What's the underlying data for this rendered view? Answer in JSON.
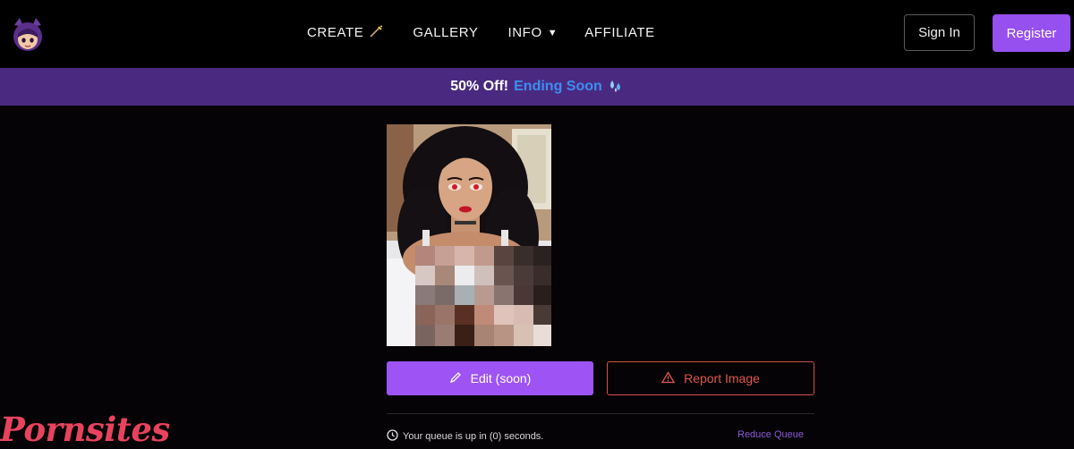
{
  "nav": {
    "links": [
      {
        "label": "CREATE",
        "icon": "wand-icon"
      },
      {
        "label": "GALLERY"
      },
      {
        "label": "INFO",
        "icon": "caret-down-icon"
      },
      {
        "label": "AFFILIATE"
      }
    ],
    "sign_in_label": "Sign In",
    "register_label": "Register"
  },
  "promo": {
    "off_text": "50% Off!",
    "soon_text": "Ending Soon",
    "icon": "droplets-icon"
  },
  "actions": {
    "edit_label": "Edit (soon)",
    "report_label": "Report Image"
  },
  "queue": {
    "status_text": "Your queue is up in (0) seconds.",
    "reduce_label": "Reduce Queue"
  },
  "watermark": "Pornsites",
  "colors": {
    "accent": "#9650f0",
    "promo_bg": "#4a2a80",
    "promo_highlight": "#3d8ef2",
    "report": "#e0564c"
  }
}
